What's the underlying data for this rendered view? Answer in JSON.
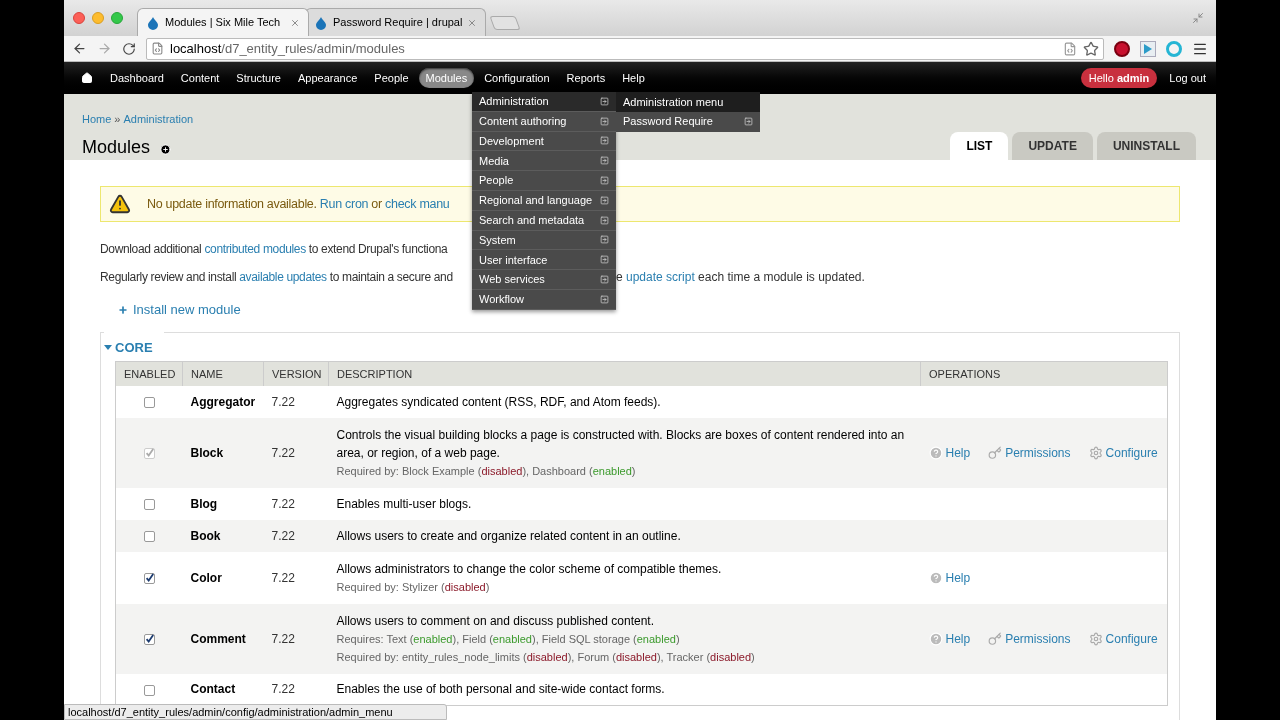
{
  "browser": {
    "tabs": [
      {
        "title": "Modules | Six Mile Tech",
        "selected": true
      },
      {
        "title": "Password Require | drupal",
        "selected": false
      }
    ],
    "url_host": "localhost",
    "url_path": "/d7_entity_rules/admin/modules"
  },
  "toolbar": {
    "items": [
      {
        "label": "Dashboard",
        "selected": false
      },
      {
        "label": "Content",
        "selected": false
      },
      {
        "label": "Structure",
        "selected": false
      },
      {
        "label": "Appearance",
        "selected": false
      },
      {
        "label": "People",
        "selected": false
      },
      {
        "label": "Modules",
        "selected": true
      },
      {
        "label": "Configuration",
        "selected": false
      },
      {
        "label": "Reports",
        "selected": false
      },
      {
        "label": "Help",
        "selected": false
      }
    ],
    "greeting": "Hello **admin**",
    "logout": "Log out"
  },
  "dropdown": {
    "items": [
      {
        "label": "Administration",
        "highlighted": true
      },
      {
        "label": "Content authoring",
        "highlighted": false
      },
      {
        "label": "Development",
        "highlighted": false
      },
      {
        "label": "Media",
        "highlighted": false
      },
      {
        "label": "People",
        "highlighted": false
      },
      {
        "label": "Regional and language",
        "highlighted": false
      },
      {
        "label": "Search and metadata",
        "highlighted": false
      },
      {
        "label": "System",
        "highlighted": false
      },
      {
        "label": "User interface",
        "highlighted": false
      },
      {
        "label": "Web services",
        "highlighted": false
      },
      {
        "label": "Workflow",
        "highlighted": false
      }
    ],
    "submenu": [
      {
        "label": "Administration menu",
        "highlighted": true,
        "has_children": false
      },
      {
        "label": "Password Require",
        "highlighted": false,
        "has_children": true
      }
    ]
  },
  "breadcrumb": {
    "items": [
      "Home",
      "Administration"
    ],
    "separator": "»"
  },
  "page_title": "Modules",
  "page_tabs": [
    {
      "label": "LIST",
      "selected": true
    },
    {
      "label": "UPDATE",
      "selected": false
    },
    {
      "label": "UNINSTALL",
      "selected": false
    }
  ],
  "alert": [
    {
      "kind": "plain",
      "text": "No update information available. "
    },
    {
      "kind": "link",
      "text": "Run cron"
    },
    {
      "kind": "plain",
      "text": " or "
    },
    {
      "kind": "link",
      "text": "check manu"
    }
  ],
  "paragraphs": [
    {
      "before_menu": [
        {
          "kind": "plain",
          "text": "Download additional "
        },
        {
          "kind": "link",
          "text": "contributed modules"
        },
        {
          "kind": "plain",
          "text": " to extend Drupal's functiona"
        }
      ]
    },
    {
      "before_menu": [
        {
          "kind": "plain",
          "text": "Regularly review and install "
        },
        {
          "kind": "link",
          "text": "available updates"
        },
        {
          "kind": "plain",
          "text": " to maintain a secure and"
        }
      ],
      "after_menu": [
        {
          "kind": "plain",
          "text": "e "
        },
        {
          "kind": "link",
          "text": "update script"
        },
        {
          "kind": "plain",
          "text": " each time a module is updated."
        }
      ]
    }
  ],
  "install_link": "Install new module",
  "fieldset": {
    "legend": "CORE",
    "expanded": true
  },
  "table": {
    "columns": [
      "ENABLED",
      "NAME",
      "VERSION",
      "DESCRIPTION",
      "OPERATIONS"
    ],
    "rows": [
      {
        "checked": false,
        "disabled": false,
        "name": "Aggregator",
        "version": "7.22",
        "description": "Aggregates syndicated content (RSS, RDF, and Atom feeds).",
        "notes": [],
        "operations": []
      },
      {
        "checked": true,
        "disabled": true,
        "name": "Block",
        "version": "7.22",
        "description": "Controls the visual building blocks a page is constructed with. Blocks are boxes of content rendered into an area, or region, of a web page.",
        "notes": [
          [
            {
              "kind": "plain",
              "text": "Required by: Block Example ("
            },
            {
              "kind": "disabled",
              "text": "disabled"
            },
            {
              "kind": "plain",
              "text": "), Dashboard ("
            },
            {
              "kind": "enabled",
              "text": "enabled"
            },
            {
              "kind": "plain",
              "text": ")"
            }
          ]
        ],
        "operations": [
          {
            "kind": "help",
            "label": "Help"
          },
          {
            "kind": "permissions",
            "label": "Permissions"
          },
          {
            "kind": "configure",
            "label": "Configure"
          }
        ]
      },
      {
        "checked": false,
        "disabled": false,
        "name": "Blog",
        "version": "7.22",
        "description": "Enables multi-user blogs.",
        "notes": [],
        "operations": []
      },
      {
        "checked": false,
        "disabled": false,
        "name": "Book",
        "version": "7.22",
        "description": "Allows users to create and organize related content in an outline.",
        "notes": [],
        "operations": []
      },
      {
        "checked": true,
        "disabled": false,
        "name": "Color",
        "version": "7.22",
        "description": "Allows administrators to change the color scheme of compatible themes.",
        "notes": [
          [
            {
              "kind": "plain",
              "text": "Required by: Stylizer ("
            },
            {
              "kind": "disabled",
              "text": "disabled"
            },
            {
              "kind": "plain",
              "text": ")"
            }
          ]
        ],
        "operations": [
          {
            "kind": "help",
            "label": "Help"
          }
        ]
      },
      {
        "checked": true,
        "disabled": false,
        "name": "Comment",
        "version": "7.22",
        "description": "Allows users to comment on and discuss published content.",
        "notes": [
          [
            {
              "kind": "plain",
              "text": "Requires: Text ("
            },
            {
              "kind": "enabled",
              "text": "enabled"
            },
            {
              "kind": "plain",
              "text": "), Field ("
            },
            {
              "kind": "enabled",
              "text": "enabled"
            },
            {
              "kind": "plain",
              "text": "), Field SQL storage ("
            },
            {
              "kind": "enabled",
              "text": "enabled"
            },
            {
              "kind": "plain",
              "text": ")"
            }
          ],
          [
            {
              "kind": "plain",
              "text": "Required by: entity_rules_node_limits ("
            },
            {
              "kind": "disabled",
              "text": "disabled"
            },
            {
              "kind": "plain",
              "text": "), Forum ("
            },
            {
              "kind": "disabled",
              "text": "disabled"
            },
            {
              "kind": "plain",
              "text": "), Tracker ("
            },
            {
              "kind": "disabled",
              "text": "disabled"
            },
            {
              "kind": "plain",
              "text": ")"
            }
          ]
        ],
        "operations": [
          {
            "kind": "help",
            "label": "Help"
          },
          {
            "kind": "permissions",
            "label": "Permissions"
          },
          {
            "kind": "configure",
            "label": "Configure"
          }
        ]
      },
      {
        "checked": false,
        "disabled": false,
        "name": "Contact",
        "version": "7.22",
        "description": "Enables the use of both personal and site-wide contact forms.",
        "notes": [],
        "operations": []
      }
    ]
  },
  "status_bar": "localhost/d7_entity_rules/admin/config/administration/admin_menu"
}
